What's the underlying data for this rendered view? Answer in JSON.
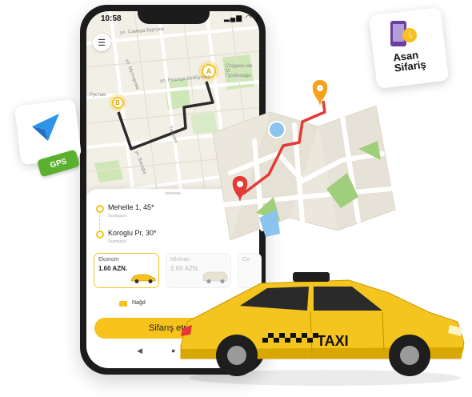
{
  "status_bar": {
    "time": "10:58",
    "icons": "▂▄▆ ◠ ▮"
  },
  "map": {
    "streets": [
      "ул. Самеда Вургуна",
      "Рустам",
      "ул. Мухтарова",
      "ул. Рашида Бейбутова",
      "Стадион им. М. Гусейнзаде",
      "ул. Вагифа",
      "Тагиева"
    ],
    "marker_a": "A",
    "marker_b": "B"
  },
  "trip": {
    "from_address": "Mehelle 1, 45*",
    "from_sub": "Sumqayıt",
    "to_address": "Koroglu Pr, 30*",
    "to_sub": "Sumqayıt"
  },
  "tariffs": [
    {
      "name": "Ekonom",
      "price": "1.60 AZN."
    },
    {
      "name": "Minivan",
      "price": "2.60 AZN."
    },
    {
      "name": "Co"
    }
  ],
  "payment": {
    "method": "Nağd"
  },
  "order_button": "Sifarış etmək",
  "nav": {
    "back": "◀",
    "home": "●",
    "recent": "■"
  },
  "badges": {
    "asan_line1": "Asan",
    "asan_line2": "Sifariş",
    "gps": "GPS"
  },
  "taxi_sign": "TAXI",
  "colors": {
    "accent": "#f7c21c",
    "route": "#e53935",
    "gps_green": "#5bb12f",
    "arrow_blue": "#2f93e8"
  }
}
